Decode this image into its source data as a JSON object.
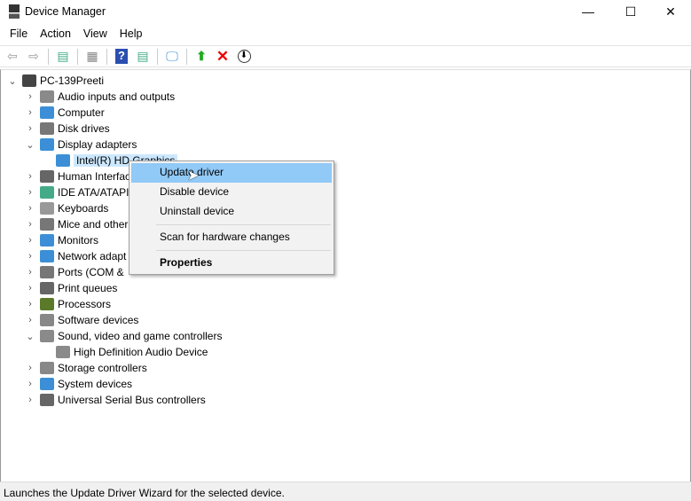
{
  "window": {
    "title": "Device Manager",
    "controls": [
      "—",
      "☐",
      "✕"
    ]
  },
  "menu": [
    "File",
    "Action",
    "View",
    "Help"
  ],
  "toolbar": {
    "icons": [
      "back-icon",
      "forward-icon",
      "show-hide-console-tree-icon",
      "properties-icon",
      "help-icon",
      "action-pane-icon",
      "scan-hardware-icon",
      "update-driver-icon",
      "uninstall-icon",
      "disable-icon"
    ]
  },
  "tree": {
    "root": "PC-139Preeti",
    "items": [
      {
        "label": "Audio inputs and outputs",
        "expanded": false,
        "color": "#8a8a8a"
      },
      {
        "label": "Computer",
        "expanded": false,
        "color": "#3c8fd6"
      },
      {
        "label": "Disk drives",
        "expanded": false,
        "color": "#777"
      },
      {
        "label": "Display adapters",
        "expanded": true,
        "color": "#3c8fd6",
        "children": [
          {
            "label": "Intel(R) HD Graphics",
            "selected": true
          }
        ]
      },
      {
        "label": "Human Interfac",
        "expanded": false,
        "color": "#666"
      },
      {
        "label": "IDE ATA/ATAPI",
        "expanded": false,
        "color": "#4a8"
      },
      {
        "label": "Keyboards",
        "expanded": false,
        "color": "#999"
      },
      {
        "label": "Mice and other",
        "expanded": false,
        "color": "#777"
      },
      {
        "label": "Monitors",
        "expanded": false,
        "color": "#3c8fd6"
      },
      {
        "label": "Network adapt",
        "expanded": false,
        "color": "#3c8fd6"
      },
      {
        "label": "Ports (COM &",
        "expanded": false,
        "color": "#777"
      },
      {
        "label": "Print queues",
        "expanded": false,
        "color": "#666"
      },
      {
        "label": "Processors",
        "expanded": false,
        "color": "#5a7a2a"
      },
      {
        "label": "Software devices",
        "expanded": false,
        "color": "#888"
      },
      {
        "label": "Sound, video and game controllers",
        "expanded": true,
        "color": "#8a8a8a",
        "children": [
          {
            "label": "High Definition Audio Device",
            "selected": false
          }
        ]
      },
      {
        "label": "Storage controllers",
        "expanded": false,
        "color": "#888"
      },
      {
        "label": "System devices",
        "expanded": false,
        "color": "#3c8fd6"
      },
      {
        "label": "Universal Serial Bus controllers",
        "expanded": false,
        "color": "#666"
      }
    ]
  },
  "context_menu": {
    "items": [
      "Update driver",
      "Disable device",
      "Uninstall device",
      "Scan for hardware changes",
      "Properties"
    ],
    "highlighted": "Update driver"
  },
  "status": "Launches the Update Driver Wizard for the selected device."
}
